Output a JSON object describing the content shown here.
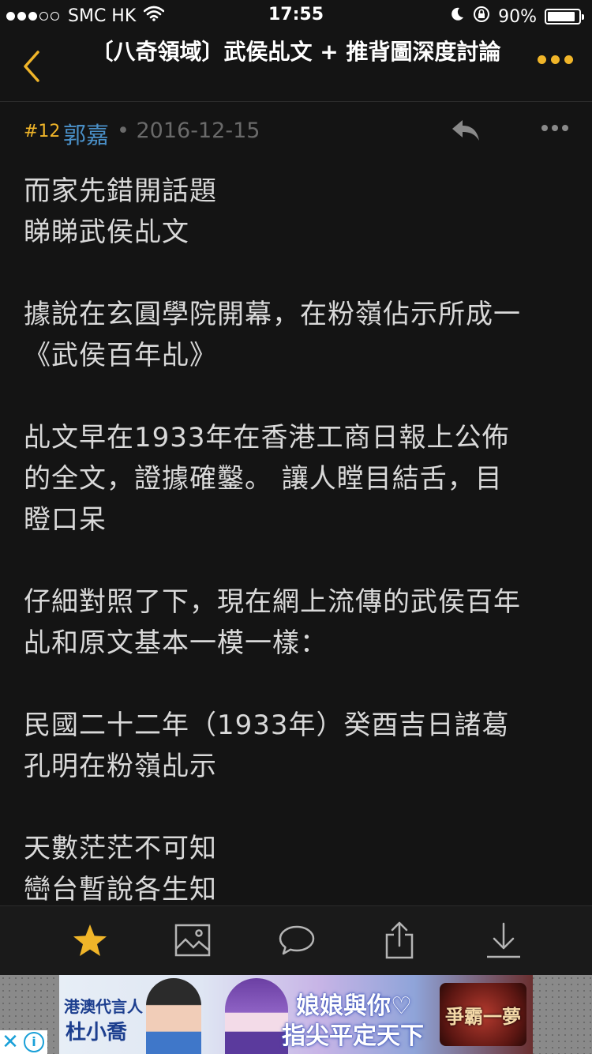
{
  "status_bar": {
    "carrier": "SMC HK",
    "time": "17:55",
    "battery_percent": "90%",
    "battery_level": 0.9,
    "signal_bars_filled": 3,
    "signal_bars_total": 5
  },
  "nav": {
    "title": "〔八奇領域〕武侯乩文 + 推背圖深度討論",
    "accent_color": "#f0b529"
  },
  "post": {
    "floor": "#12",
    "author": "郭嘉",
    "date": "• 2016-12-15",
    "paragraphs": [
      [
        "而家先錯開話題",
        "睇睇武侯乩文"
      ],
      [
        "據說在玄圓學院開幕，在粉嶺佔示所成一",
        "《武侯百年乩》"
      ],
      [
        "乩文早在1933年在香港工商日報上公佈",
        "的全文，證據確鑿。 讓人瞠目結舌，目",
        "瞪口呆"
      ],
      [
        "仔細對照了下，現在網上流傳的武侯百年",
        "乩和原文基本一模一樣："
      ],
      [
        "民國二十二年（1933年）癸酉吉日諸葛",
        "孔明在粉嶺乩示"
      ],
      [
        "天數茫茫不可知",
        "巒台暫說各生知"
      ]
    ]
  },
  "toolbar": {
    "icons": [
      "star-icon",
      "image-icon",
      "comment-icon",
      "share-icon",
      "download-icon"
    ]
  },
  "ad": {
    "line1": "港澳代言人",
    "line2": "杜小喬",
    "slogan1": "娘娘與你♡",
    "slogan2": "指尖平定天下",
    "logo": "爭霸一夢",
    "close": "✕",
    "info": "i"
  }
}
